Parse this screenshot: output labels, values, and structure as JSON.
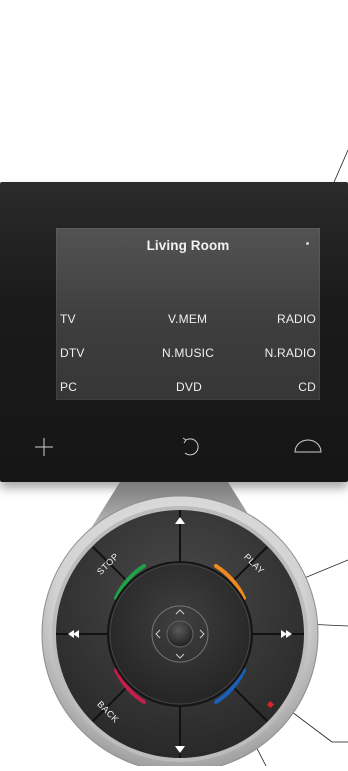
{
  "display": {
    "title": "Living Room",
    "sources": [
      {
        "id": "tv",
        "label": "TV"
      },
      {
        "id": "v-mem",
        "label": "V.MEM"
      },
      {
        "id": "radio",
        "label": "RADIO"
      },
      {
        "id": "dtv",
        "label": "DTV"
      },
      {
        "id": "n-music",
        "label": "N.MUSIC"
      },
      {
        "id": "n-radio",
        "label": "N.RADIO"
      },
      {
        "id": "pc",
        "label": "PC"
      },
      {
        "id": "dvd",
        "label": "DVD"
      },
      {
        "id": "cd",
        "label": "CD"
      }
    ],
    "softkeys": [
      {
        "name": "plus",
        "icon": "plus-icon"
      },
      {
        "name": "back-rotate",
        "icon": "rotate-back-icon"
      },
      {
        "name": "home",
        "icon": "dome-icon"
      }
    ]
  },
  "wheel": {
    "labels": {
      "stop": "STOP",
      "play": "PLAY",
      "back": "BACK"
    },
    "colors": {
      "green": "#1fa24a",
      "orange": "#f08a1d",
      "red": "#c41e4a",
      "blue": "#1c5fb8",
      "led": "#d8252b"
    },
    "icons": [
      "up-arrow-icon",
      "down-arrow-icon",
      "rewind-icon",
      "fast-forward-icon",
      "nav-up-icon",
      "nav-down-icon",
      "nav-left-icon",
      "nav-right-icon",
      "center-button"
    ]
  }
}
